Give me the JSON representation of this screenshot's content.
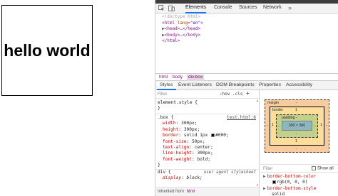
{
  "page": {
    "demo_text": "hello world"
  },
  "devtools": {
    "main_tabs": [
      "Elements",
      "Console",
      "Sources",
      "Network"
    ],
    "more_tabs": "»",
    "dom": {
      "doctype": "<!doctype html>",
      "html_open_tag": "html",
      "html_lang_attr": "lang",
      "html_lang_val": "\"en\"",
      "head_tag": "head",
      "head_ellipsis": "…",
      "body_tag": "body",
      "body_ellipsis": "…",
      "html_close": "</html>"
    },
    "breadcrumbs": [
      "html",
      "body",
      "div.box"
    ],
    "sub_tabs": [
      "Styles",
      "Event Listeners",
      "DOM Breakpoints",
      "Properties",
      "Accessibility"
    ],
    "styles": {
      "filter_placeholder": "Filter",
      "hov_label": ":hov",
      "cls_label": ".cls",
      "add_label": "+",
      "element_style": "element.style {",
      "close_brace": "}",
      "box_rule": {
        "selector": ".box {",
        "source": "test.html:8",
        "declarations": [
          {
            "name": "width",
            "value": "300px;"
          },
          {
            "name": "height",
            "value": "300px;"
          },
          {
            "name": "border",
            "value": "solid 1px",
            "swatch_value": "#000;"
          },
          {
            "name": "font-size",
            "value": "50px;"
          },
          {
            "name": "text-align",
            "value": "center;"
          },
          {
            "name": "line-height",
            "value": "300px;"
          },
          {
            "name": "font-weight",
            "value": "bold;"
          }
        ]
      },
      "div_rule": {
        "selector": "div {",
        "source": "user agent stylesheet",
        "declarations": [
          {
            "name": "display",
            "value": "block;"
          }
        ]
      },
      "inherited_label": "Inherited from",
      "inherited_tag": "html"
    },
    "computed": {
      "box_model": {
        "margin_label": "margin",
        "margin_value": "-",
        "border_label": "border",
        "border_top": "1",
        "border_left": "1",
        "border_right": "1",
        "border_bottom": "1",
        "margin_left": "-",
        "margin_right": "-",
        "margin_bottom": "-",
        "padding_label": "padding -",
        "padding_left": "-",
        "padding_right": "-",
        "padding_bottom": "-",
        "content": "300 × 300"
      },
      "filter_placeholder": "Filter",
      "show_all_label": "Show all",
      "properties": [
        {
          "name": "border-bottom-color",
          "value": "rgb(0, 0, 0)"
        },
        {
          "name": "border-bottom-style",
          "value": "solid"
        }
      ]
    },
    "colors": {
      "accent": "#1a73e8",
      "tag": "#881280",
      "property": "#c80000"
    },
    "icons": [
      "inspect-icon",
      "device-toggle-icon",
      "chevron-right-icon",
      "expand-arrow-icon"
    ]
  }
}
